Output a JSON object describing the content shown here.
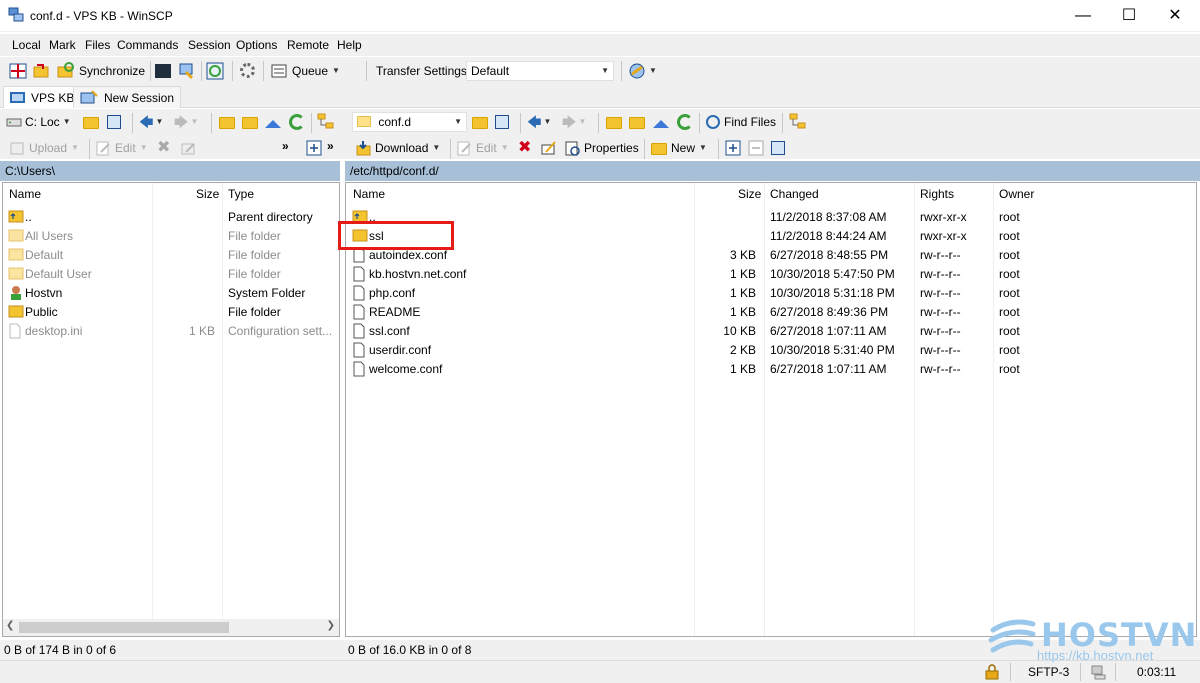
{
  "window": {
    "title": "conf.d - VPS KB - WinSCP"
  },
  "menu": [
    "Local",
    "Mark",
    "Files",
    "Commands",
    "Session",
    "Options",
    "Remote",
    "Help"
  ],
  "toolbar": {
    "synchronize": "Synchronize",
    "queue": "Queue",
    "transfer_settings": "Transfer Settings",
    "transfer_value": "Default"
  },
  "tabs": {
    "session": "VPS KB",
    "new_session": "New Session"
  },
  "local_toolbar": {
    "drive": "C: Loc",
    "upload": "Upload",
    "edit": "Edit"
  },
  "remote_toolbar": {
    "dir": "conf.d",
    "find_files": "Find Files",
    "download": "Download",
    "edit": "Edit",
    "properties": "Properties",
    "new": "New"
  },
  "local_panel": {
    "path": "C:\\Users\\",
    "columns": [
      "Name",
      "Size",
      "Type"
    ],
    "rows": [
      {
        "name": "..",
        "size": "",
        "type": "Parent directory",
        "icon": "parent-folder-icon",
        "dim": false
      },
      {
        "name": "All Users",
        "size": "",
        "type": "File folder",
        "icon": "folder-icon",
        "dim": true
      },
      {
        "name": "Default",
        "size": "",
        "type": "File folder",
        "icon": "folder-icon",
        "dim": true
      },
      {
        "name": "Default User",
        "size": "",
        "type": "File folder",
        "icon": "folder-icon",
        "dim": true
      },
      {
        "name": "Hostvn",
        "size": "",
        "type": "System Folder",
        "icon": "user-icon",
        "dim": false
      },
      {
        "name": "Public",
        "size": "",
        "type": "File folder",
        "icon": "folder-icon",
        "dim": false
      },
      {
        "name": "desktop.ini",
        "size": "1 KB",
        "type": "Configuration sett...",
        "icon": "file-icon",
        "dim": true
      }
    ],
    "status": "0 B of 174 B in 0 of 6"
  },
  "remote_panel": {
    "path": "/etc/httpd/conf.d/",
    "columns": [
      "Name",
      "Size",
      "Changed",
      "Rights",
      "Owner"
    ],
    "rows": [
      {
        "name": "..",
        "size": "",
        "changed": "11/2/2018 8:37:08 AM",
        "rights": "rwxr-xr-x",
        "owner": "root",
        "icon": "parent-folder-icon"
      },
      {
        "name": "ssl",
        "size": "",
        "changed": "11/2/2018 8:44:24 AM",
        "rights": "rwxr-xr-x",
        "owner": "root",
        "icon": "folder-icon"
      },
      {
        "name": "autoindex.conf",
        "size": "3 KB",
        "changed": "6/27/2018 8:48:55 PM",
        "rights": "rw-r--r--",
        "owner": "root",
        "icon": "file-icon"
      },
      {
        "name": "kb.hostvn.net.conf",
        "size": "1 KB",
        "changed": "10/30/2018 5:47:50 PM",
        "rights": "rw-r--r--",
        "owner": "root",
        "icon": "file-icon"
      },
      {
        "name": "php.conf",
        "size": "1 KB",
        "changed": "10/30/2018 5:31:18 PM",
        "rights": "rw-r--r--",
        "owner": "root",
        "icon": "file-icon"
      },
      {
        "name": "README",
        "size": "1 KB",
        "changed": "6/27/2018 8:49:36 PM",
        "rights": "rw-r--r--",
        "owner": "root",
        "icon": "file-icon"
      },
      {
        "name": "ssl.conf",
        "size": "10 KB",
        "changed": "6/27/2018 1:07:11 AM",
        "rights": "rw-r--r--",
        "owner": "root",
        "icon": "file-icon"
      },
      {
        "name": "userdir.conf",
        "size": "2 KB",
        "changed": "10/30/2018 5:31:40 PM",
        "rights": "rw-r--r--",
        "owner": "root",
        "icon": "file-icon"
      },
      {
        "name": "welcome.conf",
        "size": "1 KB",
        "changed": "6/27/2018 1:07:11 AM",
        "rights": "rw-r--r--",
        "owner": "root",
        "icon": "file-icon"
      }
    ],
    "status": "0 B of 16.0 KB in 0 of 8"
  },
  "statusbar": {
    "protocol": "SFTP-3",
    "elapsed": "0:03:11"
  },
  "watermark": {
    "brand": "HOSTVN",
    "url": "https://kb.hostvn.net"
  },
  "colors": {
    "pathbar": "#a7c0d7",
    "highlight": "#e41b17",
    "folder": "#f4c430"
  }
}
